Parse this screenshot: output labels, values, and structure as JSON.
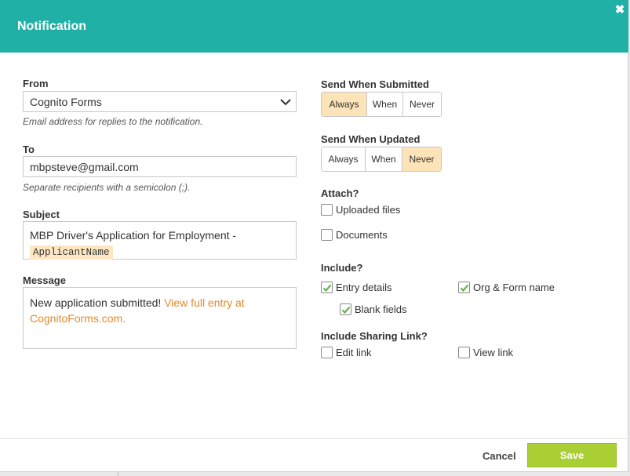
{
  "dialog": {
    "title": "Notification"
  },
  "from": {
    "label": "From",
    "value": "Cognito Forms",
    "hint": "Email address for replies to the notification."
  },
  "to": {
    "label": "To",
    "value": "mbpsteve@gmail.com",
    "hint": "Separate recipients with a semicolon (;)."
  },
  "subject": {
    "label": "Subject",
    "text": "MBP Driver's Application for Employment -",
    "token": "ApplicantName"
  },
  "message": {
    "label": "Message",
    "text": "New application submitted! ",
    "link_text": "View full entry at CognitoForms.com."
  },
  "send_when_submitted": {
    "label": "Send When Submitted",
    "options": [
      "Always",
      "When",
      "Never"
    ],
    "selected": "Always"
  },
  "send_when_updated": {
    "label": "Send When Updated",
    "options": [
      "Always",
      "When",
      "Never"
    ],
    "selected": "Never"
  },
  "attach": {
    "label": "Attach?",
    "items": [
      {
        "label": "Uploaded files",
        "checked": false
      },
      {
        "label": "Documents",
        "checked": false
      }
    ]
  },
  "include": {
    "label": "Include?",
    "items": [
      {
        "label": "Entry details",
        "checked": true
      },
      {
        "label": "Org & Form name",
        "checked": true
      },
      {
        "label": "Blank fields",
        "checked": true
      }
    ]
  },
  "sharing_link": {
    "label": "Include Sharing Link?",
    "items": [
      {
        "label": "Edit link",
        "checked": false
      },
      {
        "label": "View link",
        "checked": false
      }
    ]
  },
  "footer": {
    "cancel_label": "Cancel",
    "save_label": "Save"
  },
  "colors": {
    "header": "#20b0a5",
    "selected": "#fde4b8",
    "save": "#a9cf35",
    "link": "#e08a2c"
  }
}
